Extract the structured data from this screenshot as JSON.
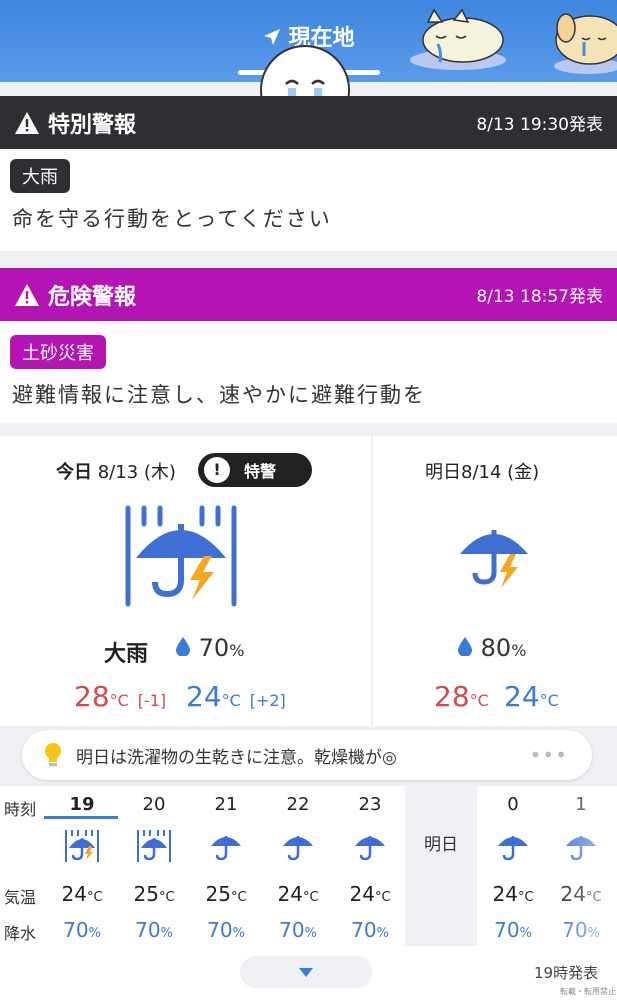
{
  "header": {
    "location_label": "現在地",
    "location_icon": "location-arrow-icon"
  },
  "special_warning": {
    "title": "特別警報",
    "time": "8/13 19:30発表",
    "tag": "大雨",
    "message": "命を守る行動をとってください",
    "color": "#2f2f33"
  },
  "danger_warning": {
    "title": "危険警報",
    "time": "8/13 18:57発表",
    "tag": "土砂災害",
    "message": "避難情報に注意し、速やかに避難行動を",
    "color": "#b514b5"
  },
  "today": {
    "label": "今日",
    "date": "8/13 (木)",
    "badge": "特警",
    "badge_icon": "!",
    "condition": "大雨",
    "pop": "70",
    "pop_unit": "%",
    "high": "28",
    "low": "24",
    "unit": "°C",
    "high_diff": "[-1]",
    "low_diff": "[+2]",
    "icon": "heavy-rain-thunder-umbrella-icon"
  },
  "tomorrow": {
    "label": "明日",
    "date": "8/14 (金)",
    "pop": "80",
    "pop_unit": "%",
    "high": "28",
    "low": "24",
    "unit": "°C",
    "icon": "umbrella-thunder-icon"
  },
  "advice": {
    "text": "明日は洗濯物の生乾きに注意。乾燥機が◎",
    "more": "•••"
  },
  "hourly": {
    "row_labels": {
      "time": "時刻",
      "temp": "気温",
      "precip": "降水"
    },
    "tomorrow_label": "明日",
    "unit_temp": "°C",
    "unit_pct": "%",
    "hours": [
      {
        "hour": "19",
        "icon": "heavy-rain-thunder-icon",
        "temp": "24",
        "precip": "70"
      },
      {
        "hour": "20",
        "icon": "heavy-rain-icon",
        "temp": "25",
        "precip": "70"
      },
      {
        "hour": "21",
        "icon": "umbrella-icon",
        "temp": "25",
        "precip": "70"
      },
      {
        "hour": "22",
        "icon": "umbrella-icon",
        "temp": "24",
        "precip": "70"
      },
      {
        "hour": "23",
        "icon": "umbrella-icon",
        "temp": "24",
        "precip": "70"
      },
      {
        "hour": "0",
        "icon": "umbrella-icon",
        "temp": "24",
        "precip": "70"
      },
      {
        "hour": "1",
        "icon": "umbrella-icon",
        "temp": "24",
        "precip": "70"
      }
    ]
  },
  "footer": {
    "issued": "19時発表",
    "note": "転載・転用禁止",
    "expand_icon": "chevron-down-icon"
  }
}
